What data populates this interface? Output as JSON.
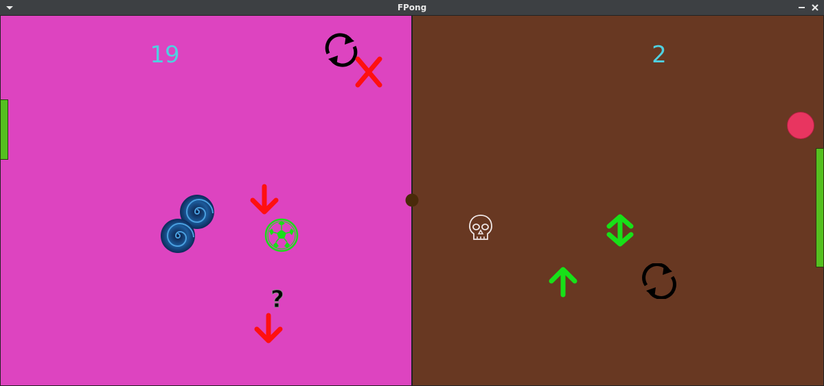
{
  "window": {
    "title": "FPong",
    "menu_icon": "chevron-down-icon",
    "minimize_icon": "minimize-icon",
    "close_icon": "close-icon"
  },
  "colors": {
    "titlebar": "#3d4043",
    "left_field": "#dd44c0",
    "right_field": "#683822",
    "score_text": "#4fd0e0",
    "paddle": "#55c020",
    "ball_main": "#e83560",
    "center_ball": "#4a2a0a",
    "powerup_red": "#ff1010",
    "powerup_green": "#18e018",
    "powerup_black": "#000000"
  },
  "scores": {
    "left": "19",
    "right": "2"
  },
  "left_field_items": [
    {
      "name": "reverse-powerup",
      "icon": "rotate-arrows-icon"
    },
    {
      "name": "cancel-powerup",
      "icon": "red-x-icon"
    },
    {
      "name": "vortex-powerup-1",
      "icon": "blue-vortex-icon"
    },
    {
      "name": "vortex-powerup-2",
      "icon": "blue-vortex-icon"
    },
    {
      "name": "down-arrow-powerup-1",
      "icon": "red-down-arrow-icon"
    },
    {
      "name": "soccer-ball-powerup",
      "icon": "green-soccer-ball-icon"
    },
    {
      "name": "mystery-powerup",
      "icon": "question-mark-icon"
    },
    {
      "name": "down-arrow-powerup-2",
      "icon": "red-down-arrow-icon"
    }
  ],
  "right_field_items": [
    {
      "name": "skull-powerup",
      "icon": "skull-icon"
    },
    {
      "name": "resize-powerup",
      "icon": "green-up-down-arrow-icon"
    },
    {
      "name": "up-arrow-powerup",
      "icon": "green-up-arrow-icon"
    },
    {
      "name": "reverse-powerup",
      "icon": "rotate-arrows-icon"
    }
  ]
}
